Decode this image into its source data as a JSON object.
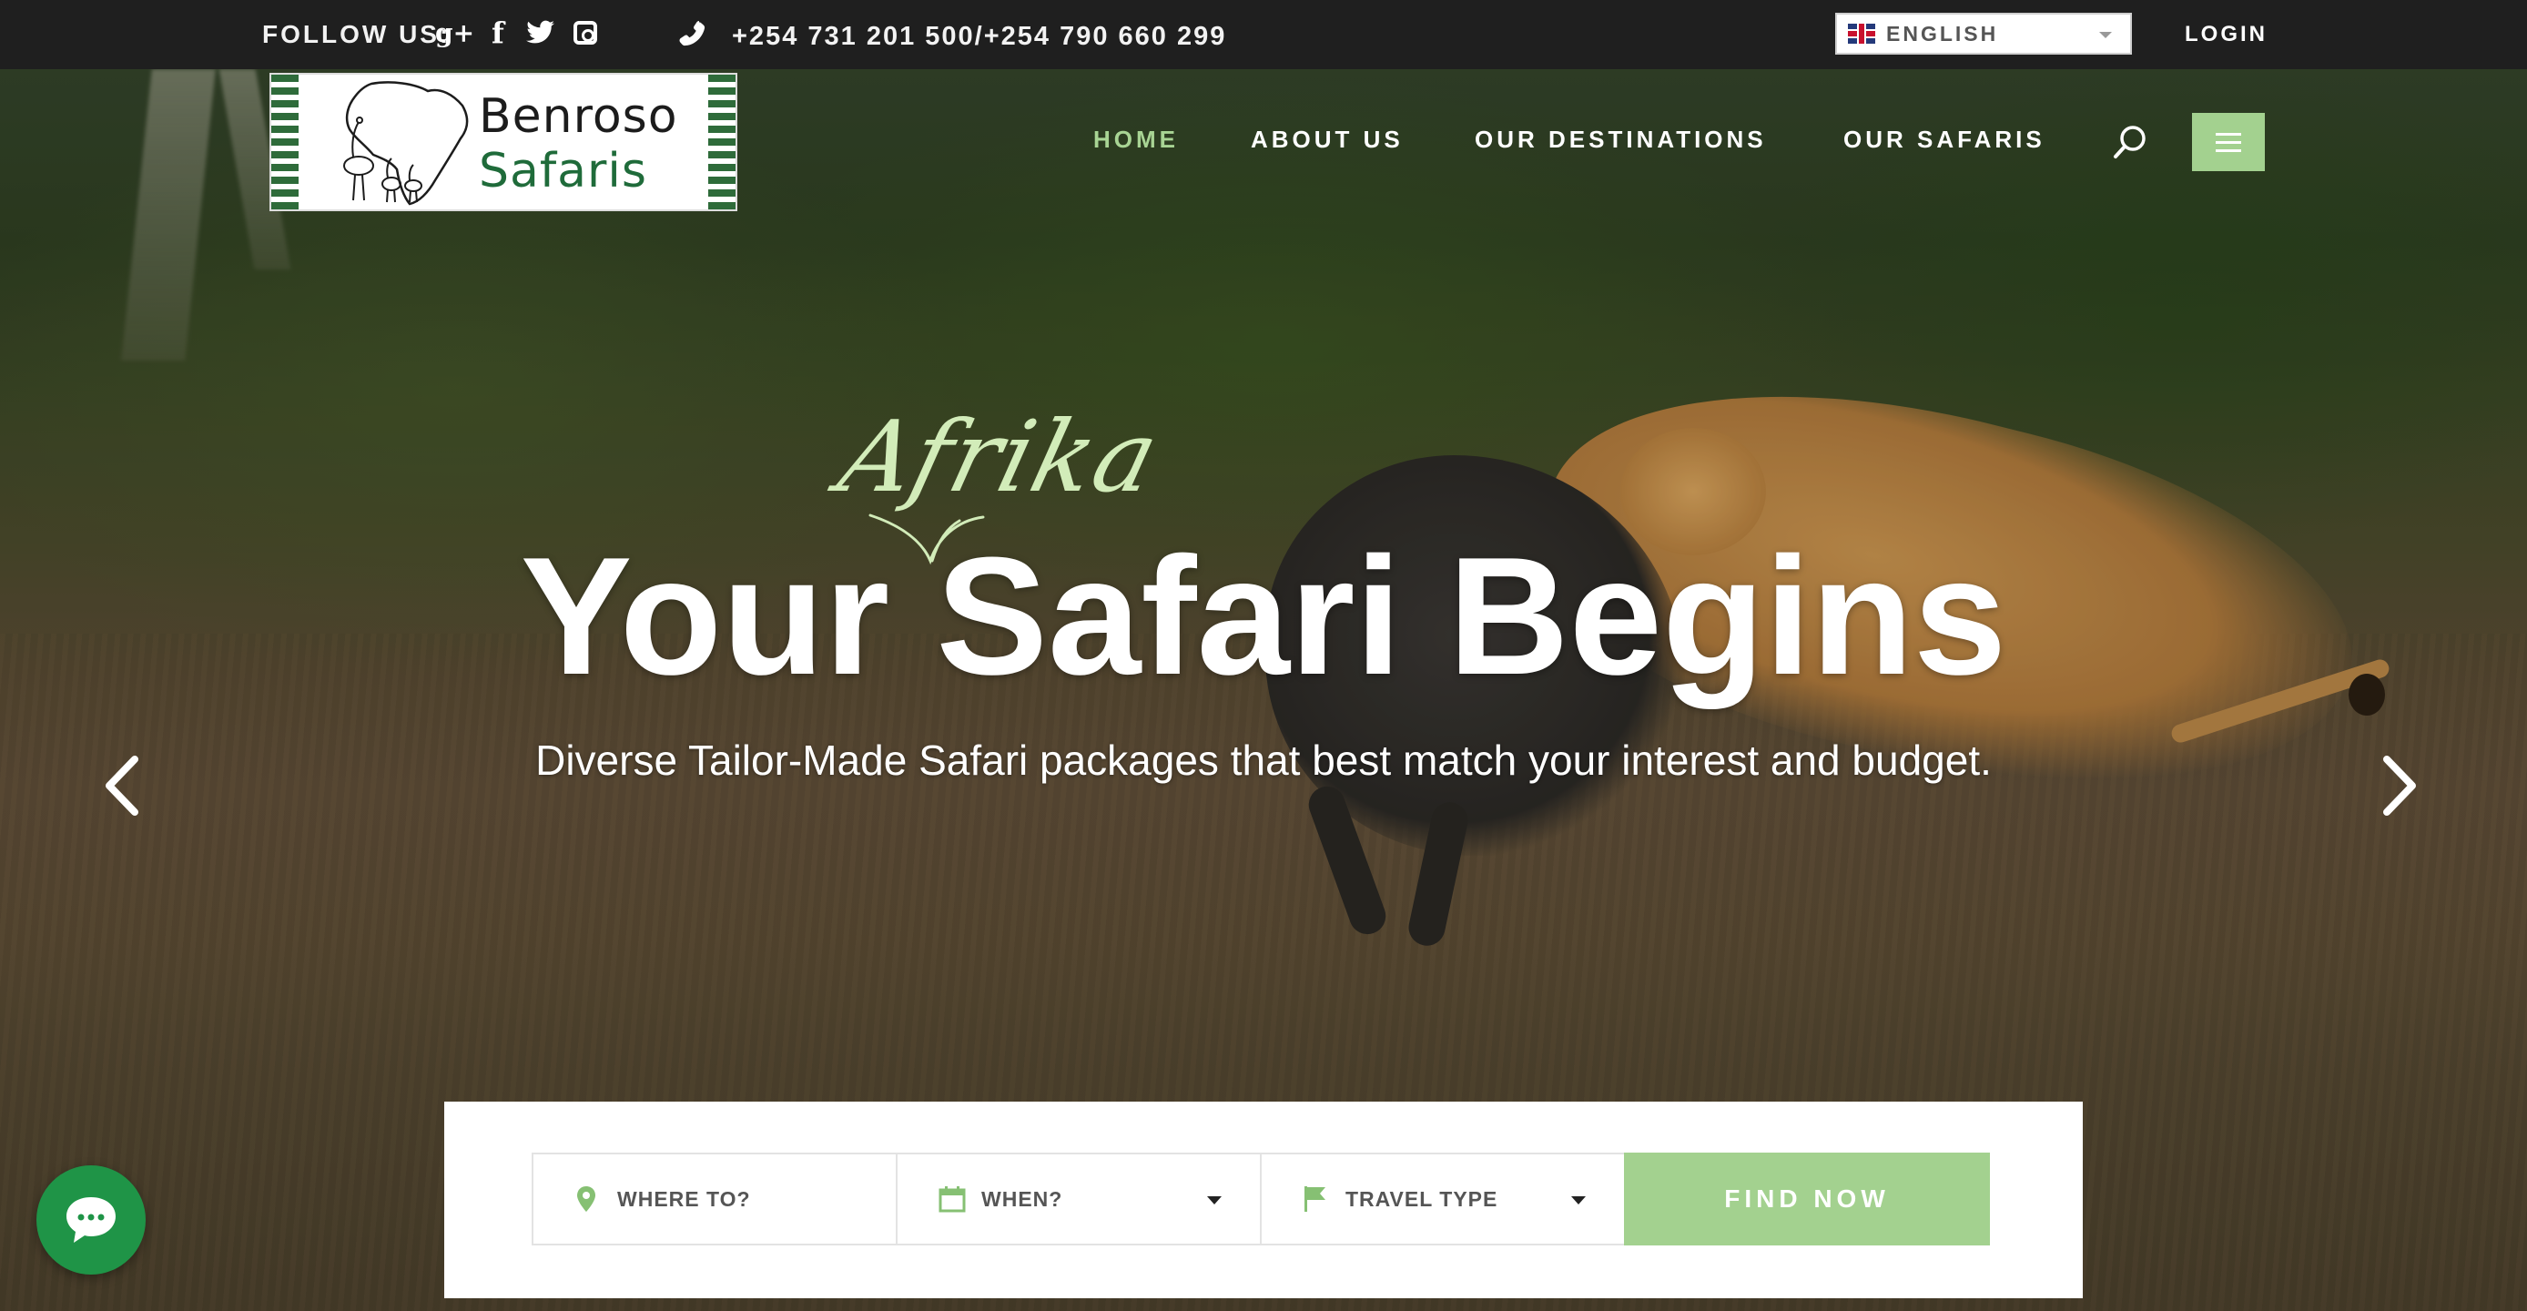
{
  "topbar": {
    "follow_label": "FOLLOW US:",
    "social_icons": [
      "google-plus-icon",
      "facebook-icon",
      "twitter-icon",
      "instagram-icon"
    ],
    "gplus_glyph": "g+",
    "facebook_glyph": "f",
    "phone": "+254 731 201 500/+254 790 660 299",
    "language": "ENGLISH",
    "login": "LOGIN"
  },
  "logo": {
    "line1": "Benroso",
    "line2": "Safaris"
  },
  "nav": {
    "items": [
      {
        "label": "HOME",
        "active": true
      },
      {
        "label": "ABOUT US",
        "active": false
      },
      {
        "label": "OUR DESTINATIONS",
        "active": false
      },
      {
        "label": "OUR SAFARIS",
        "active": false
      }
    ]
  },
  "hero": {
    "script_word": "Afrika",
    "title": "Your Safari Begins",
    "subtitle": "Diverse Tailor-Made Safari packages that best match your interest and budget."
  },
  "search": {
    "where_placeholder": "WHERE TO?",
    "when_label": "WHEN?",
    "type_label": "TRAVEL TYPE",
    "button_label": "FIND NOW"
  },
  "colors": {
    "accent_green": "#a3d18f",
    "topbar_bg": "#1f1f1f",
    "chat_green": "#1f9447",
    "script_green": "#d2ecb9"
  }
}
